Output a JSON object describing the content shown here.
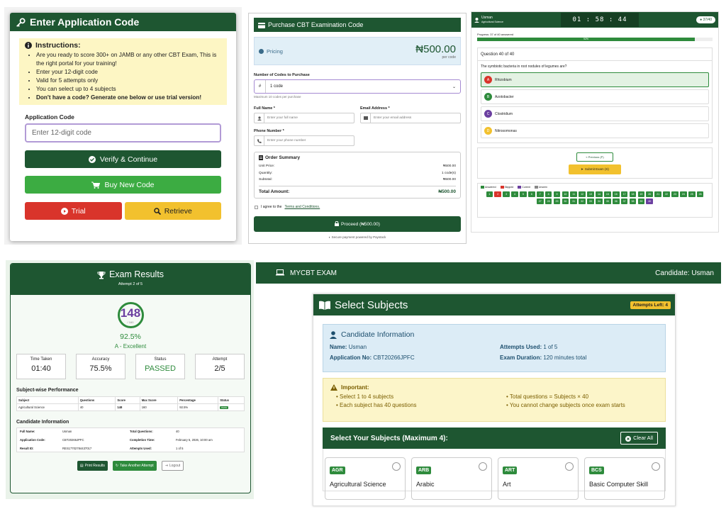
{
  "app_code": {
    "title": "Enter Application Code",
    "instructions_title": "Instructions:",
    "instructions": [
      "Are you ready to score 300+ on JAMB or any other CBT Exam, This is the right portal for your training!",
      "Enter your 12-digit code",
      "Valid for 5 attempts only",
      "You can select up to 4 subjects"
    ],
    "instructions_bold": "Don't have a code? Generate one below or use trial version!",
    "code_label": "Application Code",
    "code_placeholder": "Enter 12-digit code",
    "verify_label": "Verify & Continue",
    "buy_label": "Buy New Code",
    "trial_label": "Trial",
    "retrieve_label": "Retrieve"
  },
  "purchase": {
    "title": "Purchase CBT Examination Code",
    "pricing_label": "Pricing",
    "price": "₦500.00",
    "per_code": "per code",
    "num_codes_label": "Number of Codes to Purchase",
    "num_codes_prefix": "#",
    "num_codes_value": "1 code",
    "max_note": "Maximum 10 codes per purchase",
    "fullname_label": "Full Name *",
    "fullname_placeholder": "Enter your full name",
    "email_label": "Email Address *",
    "email_placeholder": "Enter your email address",
    "phone_label": "Phone Number *",
    "phone_placeholder": "Enter your phone number",
    "summary_title": "Order Summary",
    "summary": [
      {
        "k": "Unit Price:",
        "v": "₦500.00"
      },
      {
        "k": "Quantity:",
        "v": "1 code(s)"
      },
      {
        "k": "Subtotal:",
        "v": "₦500.00"
      }
    ],
    "total_label": "Total Amount:",
    "total_value": "₦500.00",
    "agree_text": "I agree to the",
    "terms_link": "Terms and Conditions.",
    "proceed_label": "Proceed (₦500.00)",
    "secure_text": "Secure payment powered by Paystack"
  },
  "exam": {
    "user": "Usman",
    "user_sub": "Agricultural Science",
    "timer": "01 : 58 : 44",
    "count": "37/40",
    "progress_text": "Progress: 37 of 40 answered",
    "progress_pct": "92%",
    "progress_fraction": 0.925,
    "question_header": "Question 40 of 40",
    "question": "The symbiotic bacteria in root nodules of legumes are?",
    "options": [
      {
        "letter": "A",
        "text": "Rhizobium",
        "color": "#d9342b"
      },
      {
        "letter": "B",
        "text": "Azotobacter",
        "color": "#2e8b3c"
      },
      {
        "letter": "C",
        "text": "Clostridium",
        "color": "#6b3fa0"
      },
      {
        "letter": "D",
        "text": "Nitrosomonas",
        "color": "#f2c12e"
      }
    ],
    "prev_label": "« Previous (P)",
    "submit_label": "Submit Exam (S)",
    "legend": [
      "Answered",
      "Skipped",
      "Current",
      "Unseen"
    ],
    "numbers": [
      "1",
      "2",
      "3",
      "4",
      "5",
      "6",
      "7",
      "8",
      "9",
      "10",
      "11",
      "12",
      "13",
      "14",
      "15",
      "16",
      "17",
      "18",
      "19",
      "20",
      "21",
      "22",
      "23",
      "24",
      "25",
      "26",
      "27",
      "28",
      "29",
      "30",
      "31",
      "32",
      "33",
      "34",
      "35",
      "36",
      "37",
      "38",
      "39",
      "40"
    ]
  },
  "results": {
    "title": "Exam Results",
    "attempt_sub": "Attempt 2 of 5",
    "score": "148",
    "score_max": "/ 160",
    "percent": "92.5%",
    "grade": "A - Excellent",
    "stats": [
      {
        "k": "Time Taken",
        "v": "01:40"
      },
      {
        "k": "Accuracy",
        "v": "75.5%"
      },
      {
        "k": "Status",
        "v": "PASSED"
      },
      {
        "k": "Attempt",
        "v": "2/5"
      }
    ],
    "subject_heading": "Subject-wise Performance",
    "columns": [
      "Subject",
      "Questions",
      "Score",
      "Max Score",
      "Percentage",
      "Status"
    ],
    "row": [
      "Agricultural Science",
      "40",
      "148",
      "160",
      "92.5%",
      "PASS"
    ],
    "cand_heading": "Candidate Information",
    "cand": [
      [
        "Full Name:",
        "Usman",
        "Total Questions:",
        "40"
      ],
      [
        "Application Code:",
        "CBT20266JPFC",
        "Completion Time:",
        "February 5, 2026, 10:00 am"
      ],
      [
        "Result ID:",
        "RES17702784437017",
        "Attempts Used:",
        "1 of 5"
      ]
    ],
    "print_label": "Print Results",
    "again_label": "Take Another Attempt",
    "logout_label": "Logout"
  },
  "subjects": {
    "brand": "MYCBT EXAM",
    "candidate_top": "Candidate: Usman",
    "title": "Select Subjects",
    "attempts_left": "Attempts Left: 4",
    "cand_title": "Candidate Information",
    "name_k": "Name:",
    "name_v": "Usman",
    "used_k": "Attempts Used:",
    "used_v": "1 of 5",
    "app_k": "Application No:",
    "app_v": "CBT20266JPFC",
    "dur_k": "Exam Duration:",
    "dur_v": "120 minutes total",
    "imp_title": "Important:",
    "imp": [
      "Select 1 to 4 subjects",
      "Total questions = Subjects × 40",
      "Each subject has 40 questions",
      "You cannot change subjects once exam starts"
    ],
    "select_heading": "Select Your Subjects (Maximum 4):",
    "clear_label": "Clear All",
    "items": [
      {
        "code": "AGR",
        "name": "Agricultural Science"
      },
      {
        "code": "ARB",
        "name": "Arabic"
      },
      {
        "code": "ART",
        "name": "Art"
      },
      {
        "code": "BCS",
        "name": "Basic Computer Skill"
      }
    ]
  },
  "colors": {
    "primary": "#1e5631",
    "success": "#2e8b3c",
    "danger": "#d9342b",
    "warning": "#f2c12e",
    "purple": "#6b3fa0"
  }
}
